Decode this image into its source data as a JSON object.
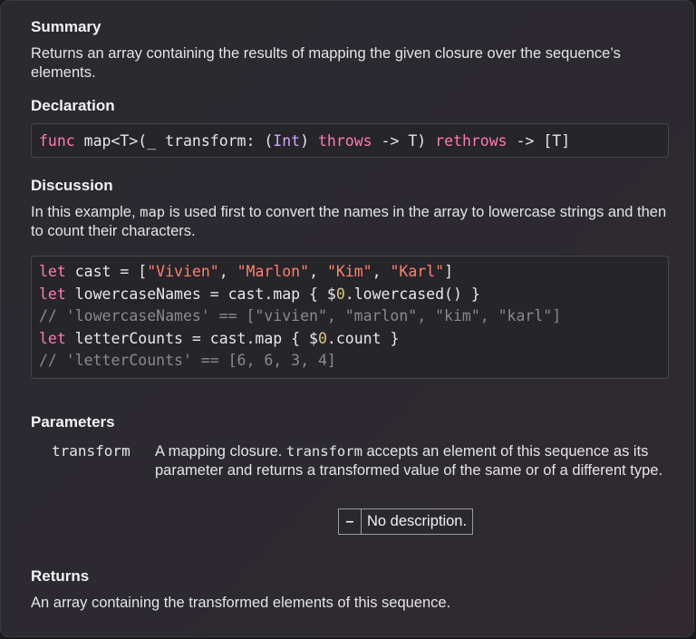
{
  "summary": {
    "title": "Summary",
    "text": "Returns an array containing the results of mapping the given closure over the sequence’s elements."
  },
  "declaration": {
    "title": "Declaration",
    "tokens": {
      "func": "func",
      "name": " map<T>(_ transform: (",
      "int": "Int",
      "close": ") ",
      "throws": "throws",
      "arrow": " -> T) ",
      "rethrows": "rethrows",
      "ret": " -> [T]"
    }
  },
  "discussion": {
    "title": "Discussion",
    "text_before": "In this example, ",
    "code_word": "map",
    "text_after": " is used first to convert the names in the array to lowercase strings and then to count their characters.",
    "code": {
      "l1": {
        "kw": "let",
        "a": " cast = [",
        "s1": "\"Vivien\"",
        "c1": ", ",
        "s2": "\"Marlon\"",
        "c2": ", ",
        "s3": "\"Kim\"",
        "c3": ", ",
        "s4": "\"Karl\"",
        "end": "]"
      },
      "l2": {
        "kw": "let",
        "a": " lowercaseNames = cast.map { $",
        "n": "0",
        "b": ".lowercased() }"
      },
      "l3": "// 'lowercaseNames' == [\"vivien\", \"marlon\", \"kim\", \"karl\"]",
      "l4": {
        "kw": "let",
        "a": " letterCounts = cast.map { $",
        "n": "0",
        "b": ".count }"
      },
      "l5": "// 'letterCounts' == [6, 6, 3, 4]"
    }
  },
  "parameters": {
    "title": "Parameters",
    "name": "transform",
    "desc_before": "A mapping closure. ",
    "desc_code": "transform",
    "desc_after": " accepts an element of this sequence as its parameter and returns a transformed value of the same or of a different type.",
    "no_description_dash": "–",
    "no_description_text": "No description."
  },
  "returns": {
    "title": "Returns",
    "text": "An array containing the transformed elements of this sequence."
  },
  "colors": {
    "keyword": "#ff7ab2",
    "string": "#ff8170",
    "type": "#d0a8ff",
    "number": "#d9c97c",
    "comment": "#8a8a90"
  }
}
